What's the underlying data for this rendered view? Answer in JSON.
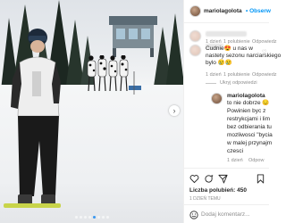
{
  "post": {
    "author": "mariolagolota",
    "follow_label": "• Obserw",
    "carousel": {
      "next_glyph": "›",
      "dot_count": 8,
      "active_dot": 4
    }
  },
  "comments": [
    {
      "blurred_author": true,
      "time": "1 dzień",
      "replies_label": "1 polubienie",
      "reply_label": "Odpowiedz",
      "text_lines": [
        "Cudnie😍 u nas w",
        "nastety sezonu narciarskiego",
        "bylo 😢😢"
      ],
      "meta_time": "1 dzień",
      "meta_likes": "1 polubienie",
      "meta_reply": "Odpowiedz"
    }
  ],
  "hidden_replies": "Ukryj odpowiedzi",
  "reply": {
    "author": "mariolagolota",
    "text_lines": [
      "to nie dobrze 😔",
      "Powinien byc z",
      "restrykcjami i lim",
      "bez odbierania tu",
      "mozliwosci \"bycia",
      "w malej przynajm",
      "czesci"
    ],
    "time": "1 dzień",
    "reply_label": "Odpow"
  },
  "footer": {
    "likes_label": "Liczba polubień:",
    "likes_count": "450",
    "date": "1 DZIEŃ TEMU",
    "add_comment_placeholder": "Dodaj komentarz..."
  },
  "icons": [
    "heart-icon",
    "comment-icon",
    "share-icon",
    "bookmark-icon",
    "emoji-icon",
    "chevron-right-icon"
  ]
}
